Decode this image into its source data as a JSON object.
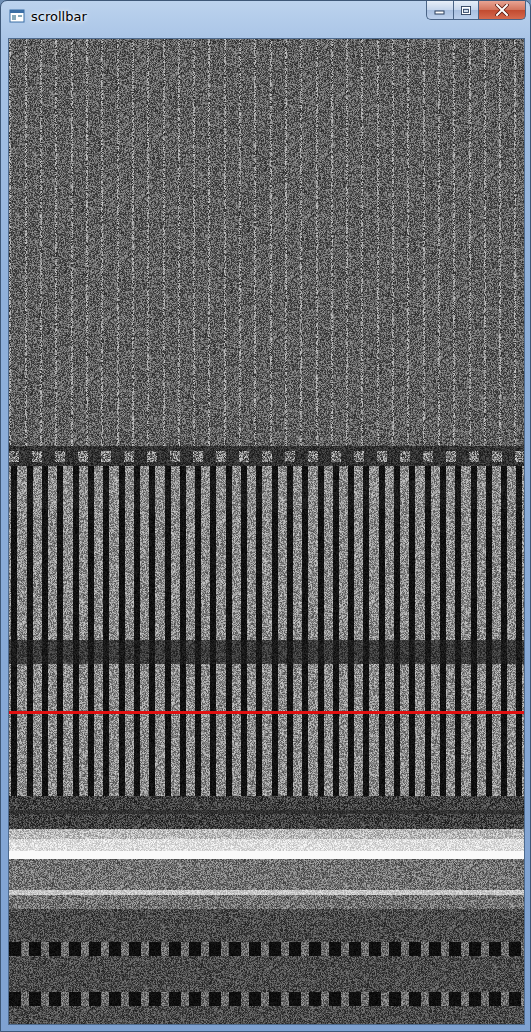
{
  "window": {
    "title": "scrollbar"
  },
  "scroll_position": {
    "level": 0.682
  }
}
